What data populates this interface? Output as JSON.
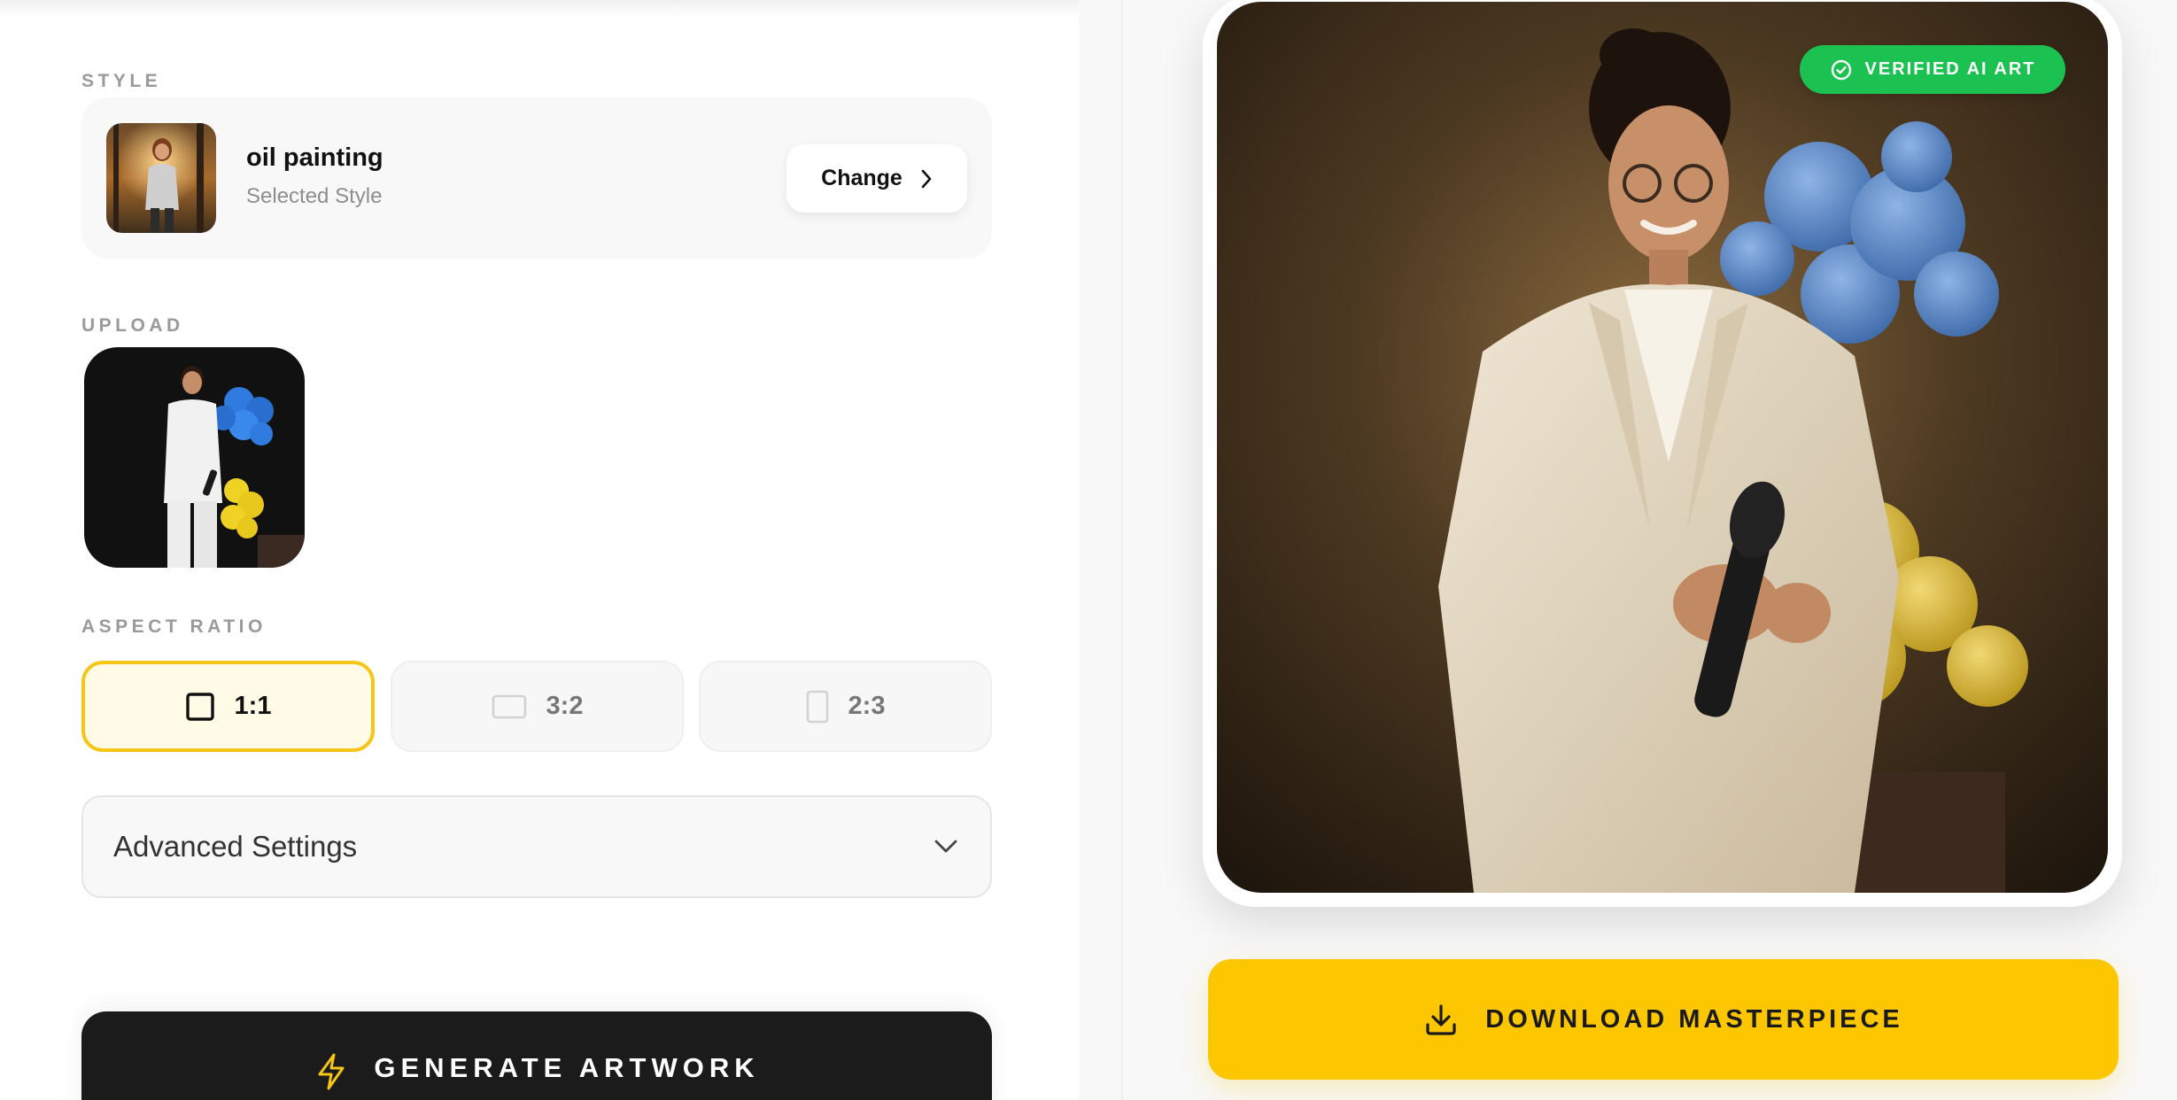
{
  "style_section": {
    "label": "STYLE",
    "name": "oil painting",
    "subtitle": "Selected Style",
    "change_label": "Change"
  },
  "upload_section": {
    "label": "UPLOAD"
  },
  "aspect_section": {
    "label": "ASPECT RATIO",
    "options": [
      {
        "label": "1:1",
        "selected": true
      },
      {
        "label": "3:2",
        "selected": false
      },
      {
        "label": "2:3",
        "selected": false
      }
    ]
  },
  "advanced": {
    "label": "Advanced Settings"
  },
  "generate": {
    "label": "GENERATE ARTWORK",
    "icon": "lightning-icon"
  },
  "preview": {
    "badge": "VERIFIED AI ART",
    "download_label": "DOWNLOAD MASTERPIECE"
  },
  "colors": {
    "accent_yellow": "#fcc700",
    "verified_green": "#1cc251",
    "dark_button": "#1b1b1c"
  }
}
